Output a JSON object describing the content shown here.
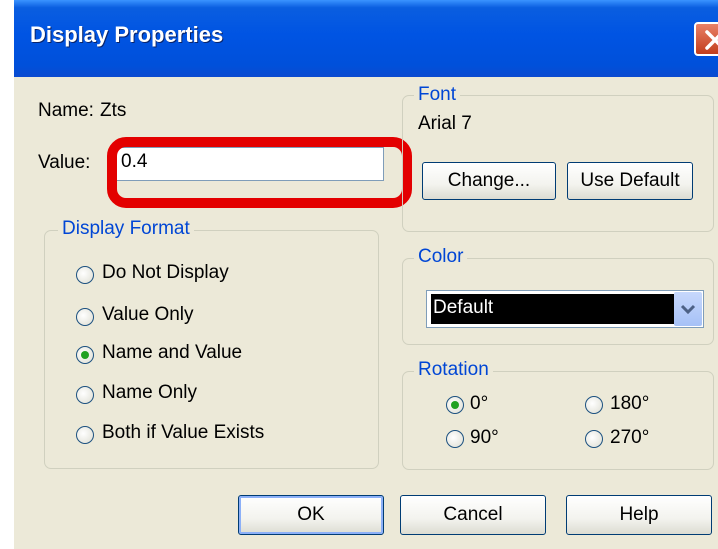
{
  "window": {
    "title": "Display Properties"
  },
  "name_row": {
    "label": "Name:",
    "value": "Zts"
  },
  "value_row": {
    "label": "Value:",
    "value": "0.4"
  },
  "display_format": {
    "legend": "Display Format",
    "options": [
      "Do Not Display",
      "Value Only",
      "Name and Value",
      "Name Only",
      "Both if Value Exists"
    ],
    "selected": "Name and Value"
  },
  "font": {
    "legend": "Font",
    "current": "Arial 7",
    "change_label": "Change...",
    "default_label": "Use Default"
  },
  "color": {
    "legend": "Color",
    "selected": "Default"
  },
  "rotation": {
    "legend": "Rotation",
    "options": [
      "0°",
      "180°",
      "90°",
      "270°"
    ],
    "selected": "0°"
  },
  "buttons": {
    "ok": "OK",
    "cancel": "Cancel",
    "help": "Help"
  },
  "colors": {
    "titlebar": "#0054e3",
    "dialog_bg": "#ece9d8",
    "group_label": "#0046d5",
    "highlight": "#e30000",
    "radio_dot": "#21a121"
  }
}
